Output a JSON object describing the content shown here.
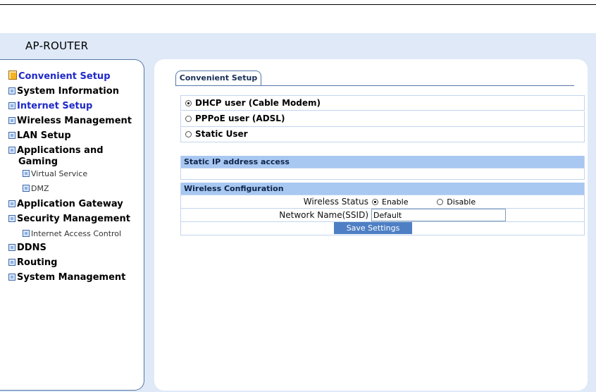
{
  "app": {
    "title": "AP-ROUTER"
  },
  "sidebar": {
    "items": [
      {
        "label": "Convenient Setup"
      },
      {
        "label": "System Information"
      },
      {
        "label": "Internet Setup"
      },
      {
        "label": "Wireless Management"
      },
      {
        "label": "LAN Setup"
      },
      {
        "label": "Applications and"
      },
      {
        "label": "Gaming"
      },
      {
        "label": "Virtual Service"
      },
      {
        "label": "DMZ"
      },
      {
        "label": "Application Gateway"
      },
      {
        "label": "Security Management"
      },
      {
        "label": "Internet Access Control"
      },
      {
        "label": "DDNS"
      },
      {
        "label": "Routing"
      },
      {
        "label": "System Management"
      }
    ]
  },
  "main": {
    "tab": "Convenient Setup",
    "connection_options": [
      {
        "label": "DHCP user (Cable Modem)",
        "selected": true
      },
      {
        "label": "PPPoE user (ADSL)",
        "selected": false
      },
      {
        "label": "Static User",
        "selected": false
      }
    ],
    "static_section": "Static IP address access",
    "wireless_section": "Wireless Configuration",
    "wireless_status_label": "Wireless Status",
    "enable_label": "Enable",
    "disable_label": "Disable",
    "ssid_label": "Network Name(SSID)",
    "ssid_value": "Default",
    "save_button": "Save Settings"
  },
  "colors": {
    "page_bg": "#dfe9f8",
    "section_header": "#a8c8f2",
    "save_button": "#4e7fc4",
    "link_blue": "#1f29c9",
    "active_icon": "#f5b321"
  }
}
